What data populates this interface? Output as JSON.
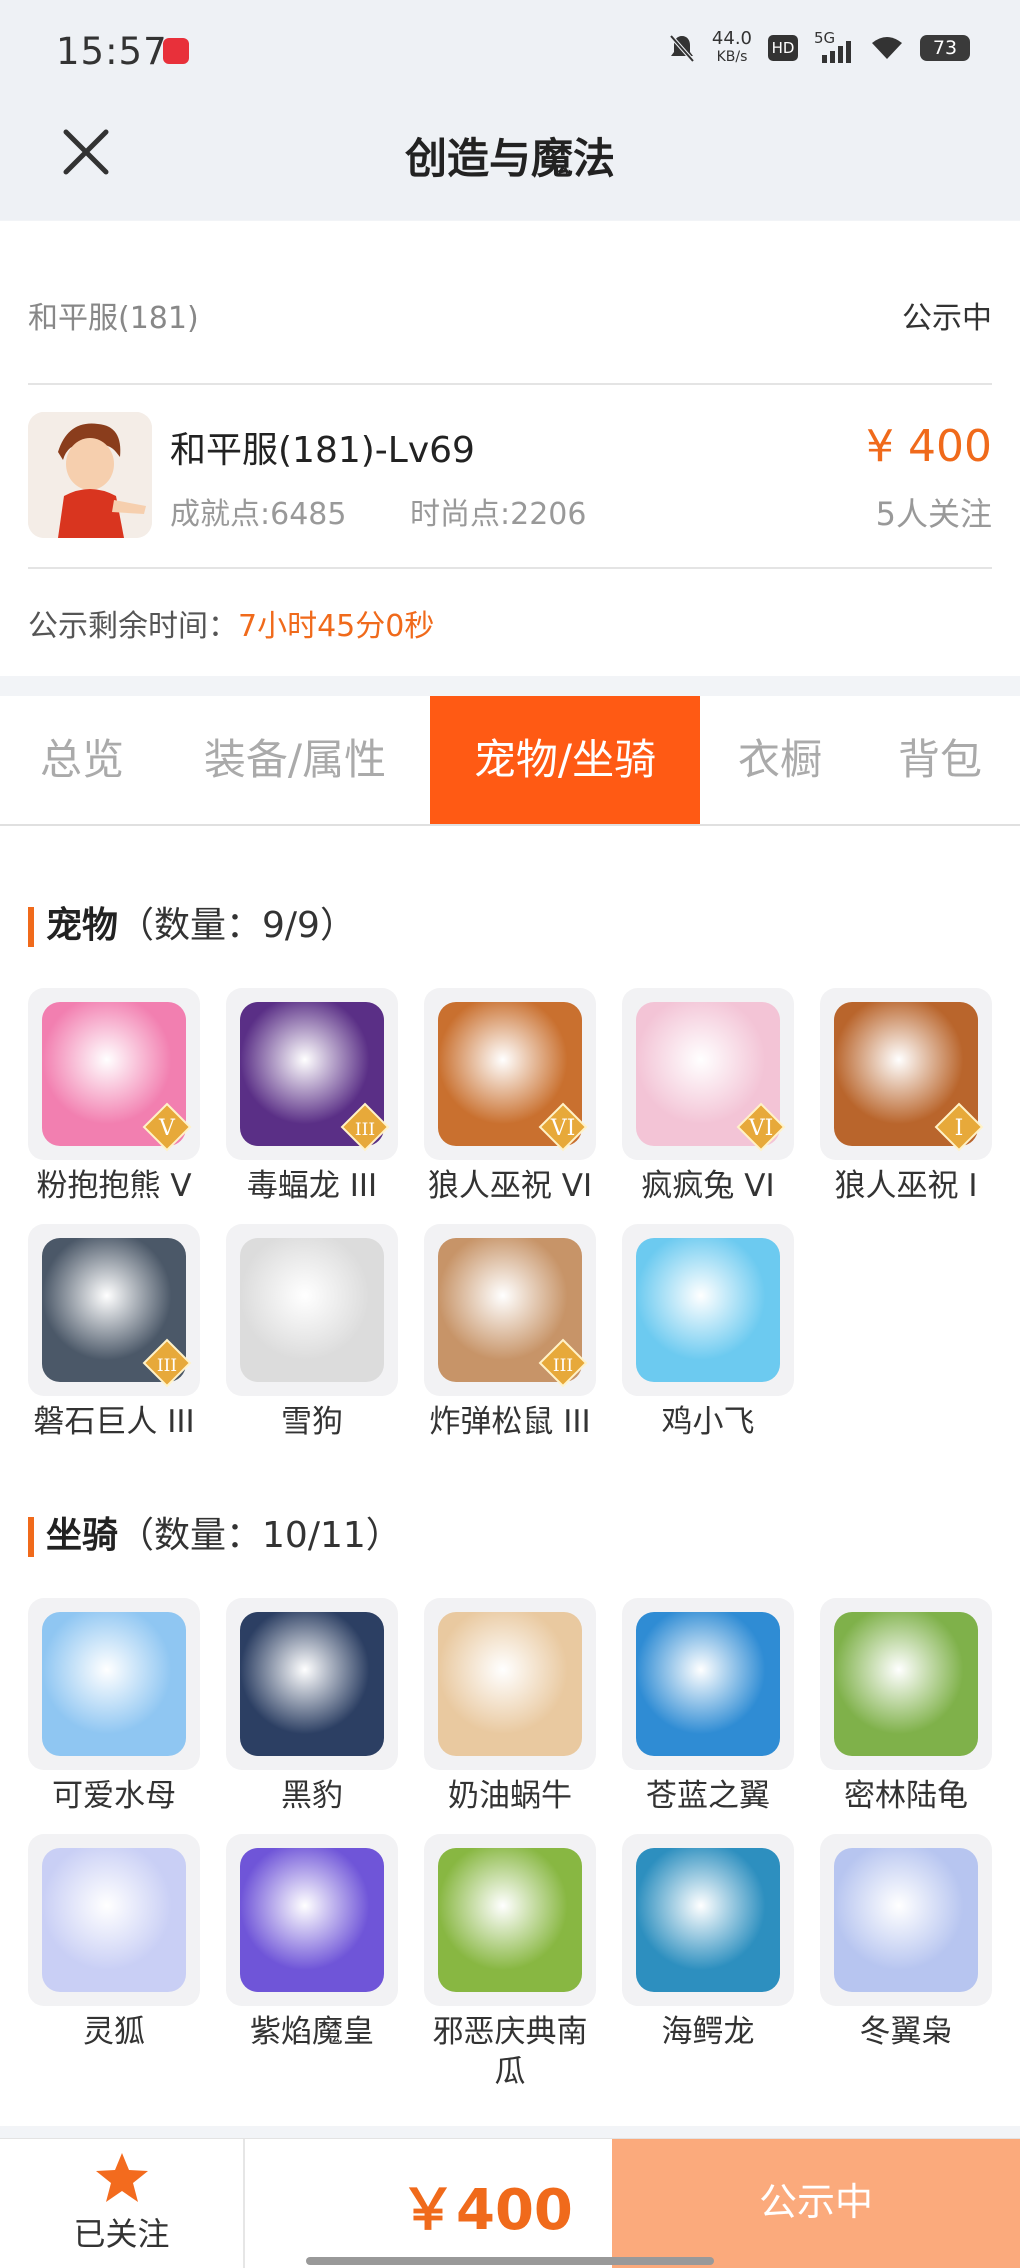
{
  "status_bar": {
    "time": "15:57",
    "net_speed_value": "44.0",
    "net_speed_unit": "KB/s",
    "hd_label": "HD",
    "signal_label": "5G",
    "battery": "73"
  },
  "title_bar": {
    "title": "创造与魔法"
  },
  "account": {
    "server": "和平服(181)",
    "status": "公示中",
    "character_name": "和平服(181)-Lv69",
    "achievement": "成就点:6485",
    "fashion": "时尚点:2206",
    "price": "¥ 400",
    "watchers": "5人关注",
    "remain_label": "公示剩余时间：",
    "remain_time": "7小时45分0秒"
  },
  "tabs": [
    {
      "label": "总览"
    },
    {
      "label": "装备/属性"
    },
    {
      "label": "宠物/坐骑"
    },
    {
      "label": "衣橱"
    },
    {
      "label": "背包"
    }
  ],
  "active_tab": "宠物/坐骑",
  "pets": {
    "title": "宠物",
    "count": "（数量：9/9）",
    "items": [
      {
        "name": "粉抱抱熊 V",
        "badge": "V",
        "color": "#f27fb0"
      },
      {
        "name": "毒蝠龙 III",
        "badge": "III",
        "color": "#5a2f86"
      },
      {
        "name": "狼人巫祝 VI",
        "badge": "VI",
        "color": "#c9702f"
      },
      {
        "name": "疯疯兔 VI",
        "badge": "VI",
        "color": "#f3c4d6"
      },
      {
        "name": "狼人巫祝 I",
        "badge": "I",
        "color": "#b9652c"
      },
      {
        "name": "磐石巨人 III",
        "badge": "III",
        "color": "#4b5868"
      },
      {
        "name": "雪狗",
        "badge": "",
        "color": "#dcdcdc"
      },
      {
        "name": "炸弹松鼠 III",
        "badge": "III",
        "color": "#c79468"
      },
      {
        "name": "鸡小飞",
        "badge": "",
        "color": "#6ccaf0"
      }
    ]
  },
  "mounts": {
    "title": "坐骑",
    "count": "（数量：10/11）",
    "items": [
      {
        "name": "可爱水母",
        "color": "#8fc6f2"
      },
      {
        "name": "黑豹",
        "color": "#2c3f63"
      },
      {
        "name": "奶油蜗牛",
        "color": "#e9c9a0"
      },
      {
        "name": "苍蓝之翼",
        "color": "#2f8cd4"
      },
      {
        "name": "密林陆龟",
        "color": "#7fb14a"
      },
      {
        "name": "灵狐",
        "color": "#c9cff5"
      },
      {
        "name": "紫焰魔皇",
        "color": "#6f55d8"
      },
      {
        "name": "邪恶庆典南瓜",
        "color": "#88b742"
      },
      {
        "name": "海鳄龙",
        "color": "#2d8fbf"
      },
      {
        "name": "冬翼枭",
        "color": "#b7c5f0"
      }
    ]
  },
  "bottom_bar": {
    "follow_label": "已关注",
    "price": "￥400",
    "status_button": "公示中"
  },
  "colors": {
    "accent": "#f06a1b",
    "tab_active": "#ff5a14",
    "status_button": "#fbaa7c"
  }
}
